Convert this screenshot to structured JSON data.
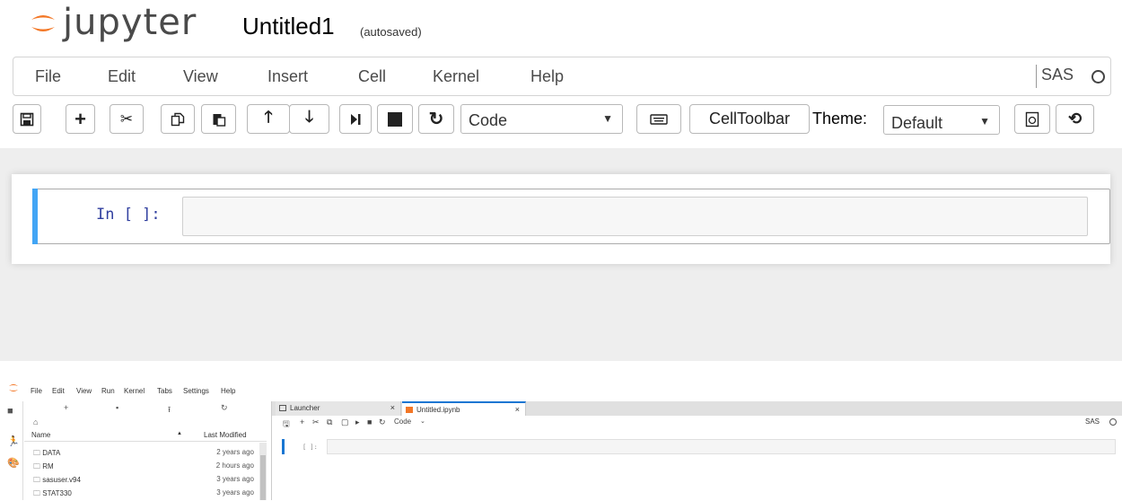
{
  "notebook": {
    "logo_text": "jupyter",
    "title": "Untitled1",
    "autosave": "(autosaved)",
    "menu": [
      "File",
      "Edit",
      "View",
      "Insert",
      "Cell",
      "Kernel",
      "Help"
    ],
    "kernel_name": "SAS",
    "toolbar": {
      "cell_type": "Code",
      "celltoolbar_label": "CellToolbar",
      "theme_label": "Theme:",
      "theme_value": "Default"
    },
    "cell": {
      "prompt": "In [ ]:"
    }
  },
  "lab": {
    "menu": [
      "File",
      "Edit",
      "View",
      "Run",
      "Kernel",
      "Tabs",
      "Settings",
      "Help"
    ],
    "filebrowser": {
      "columns": {
        "name": "Name",
        "last_modified": "Last Modified"
      },
      "rows": [
        {
          "name": "DATA",
          "modified": "2 years ago"
        },
        {
          "name": "RM",
          "modified": "2 hours ago"
        },
        {
          "name": "sasuser.v94",
          "modified": "3 years ago"
        },
        {
          "name": "STAT330",
          "modified": "3 years ago"
        }
      ]
    },
    "tabs": [
      {
        "label": "Launcher"
      },
      {
        "label": "Untitled.ipynb"
      }
    ],
    "toolbar": {
      "cell_type": "Code",
      "kernel_name": "SAS"
    },
    "cell": {
      "prompt": "[ ]:"
    }
  },
  "colors": {
    "accent_blue": "#42a5f5",
    "lab_blue": "#1976d2",
    "jupyter_orange": "#f37726"
  }
}
